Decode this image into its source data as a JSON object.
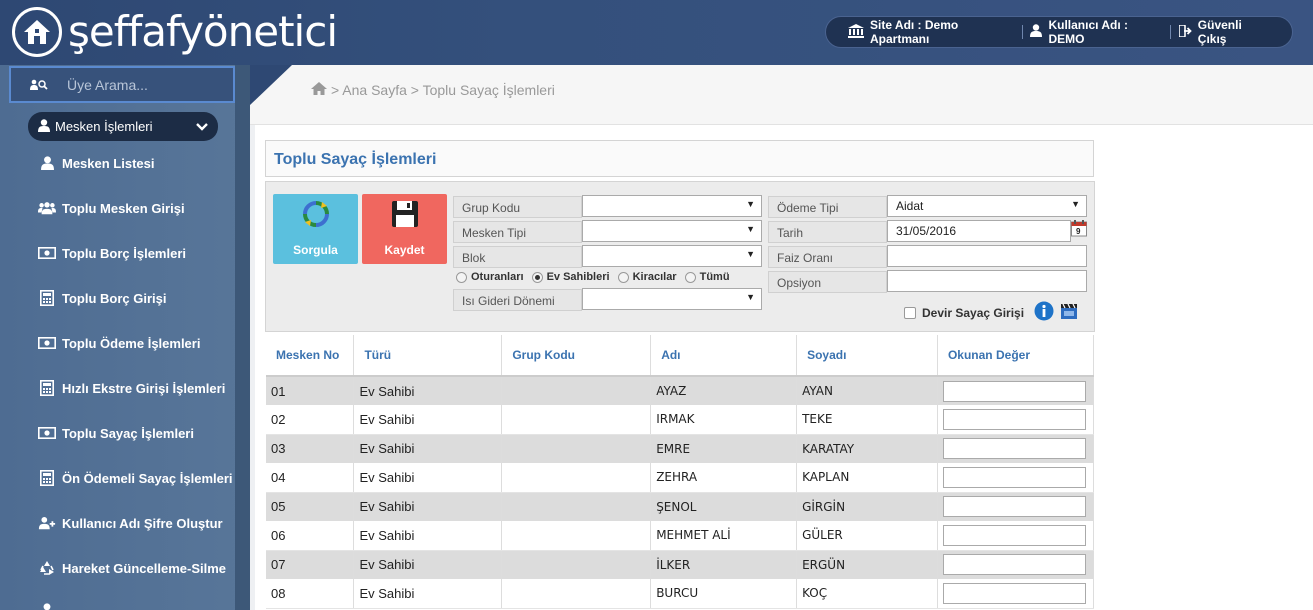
{
  "header": {
    "logo_text": "şeffafyönetici",
    "site": "Site Adı : Demo Apartmanı",
    "user": "Kullanıcı Adı : DEMO",
    "logout": "Güvenli Çıkış"
  },
  "sidebar": {
    "search_placeholder": "Üye Arama...",
    "group_label": "Mesken İşlemleri",
    "items": [
      {
        "label": "Mesken Listesi",
        "icon": "user-icon"
      },
      {
        "label": "Toplu Mesken Girişi",
        "icon": "users-icon"
      },
      {
        "label": "Toplu Borç İşlemleri",
        "icon": "money-icon"
      },
      {
        "label": "Toplu Borç Girişi",
        "icon": "calculator-icon"
      },
      {
        "label": "Toplu Ödeme İşlemleri",
        "icon": "money-icon"
      },
      {
        "label": "Hızlı Ekstre Girişi İşlemleri",
        "icon": "calculator-icon"
      },
      {
        "label": "Toplu Sayaç İşlemleri",
        "icon": "money-icon"
      },
      {
        "label": "Ön Ödemeli Sayaç İşlemleri",
        "icon": "calculator-icon"
      },
      {
        "label": "Kullanıcı Adı Şifre Oluştur",
        "icon": "user-plus-icon"
      },
      {
        "label": "Hareket Güncelleme-Silme",
        "icon": "recycle-icon"
      }
    ]
  },
  "breadcrumb": {
    "text": "> Ana Sayfa > Toplu Sayaç İşlemleri"
  },
  "panel": {
    "title": "Toplu Sayaç İşlemleri"
  },
  "buttons": {
    "query": "Sorgula",
    "save": "Kaydet"
  },
  "filters": {
    "grup_kodu": {
      "label": "Grup Kodu",
      "value": ""
    },
    "mesken_tipi": {
      "label": "Mesken Tipi",
      "value": ""
    },
    "blok": {
      "label": "Blok",
      "value": ""
    },
    "isi_gideri": {
      "label": "Isı Gideri Dönemi",
      "value": ""
    },
    "odeme_tipi": {
      "label": "Ödeme Tipi",
      "value": "Aidat"
    },
    "tarih": {
      "label": "Tarih",
      "value": "31/05/2016"
    },
    "faiz_orani": {
      "label": "Faiz Oranı",
      "value": ""
    },
    "opsiyon": {
      "label": "Opsiyon",
      "value": ""
    },
    "radios": [
      {
        "label": "Oturanları",
        "checked": false
      },
      {
        "label": "Ev Sahibleri",
        "checked": true
      },
      {
        "label": "Kiracılar",
        "checked": false
      },
      {
        "label": "Tümü",
        "checked": false
      }
    ],
    "devir_label": "Devir Sayaç Girişi"
  },
  "table": {
    "headers": [
      "Mesken No",
      "Türü",
      "Grup Kodu",
      "Adı",
      "Soyadı",
      "Okunan Değer"
    ],
    "rows": [
      [
        "01",
        "Ev Sahibi",
        "",
        "AYAZ",
        "AYAN",
        ""
      ],
      [
        "02",
        "Ev Sahibi",
        "",
        "IRMAK",
        "TEKE",
        ""
      ],
      [
        "03",
        "Ev Sahibi",
        "",
        "EMRE",
        "KARATAY",
        ""
      ],
      [
        "04",
        "Ev Sahibi",
        "",
        "ZEHRA",
        "KAPLAN",
        ""
      ],
      [
        "05",
        "Ev Sahibi",
        "",
        "ŞENOL",
        "GİRGİN",
        ""
      ],
      [
        "06",
        "Ev Sahibi",
        "",
        "MEHMET ALİ",
        "GÜLER",
        ""
      ],
      [
        "07",
        "Ev Sahibi",
        "",
        "İLKER",
        "ERGÜN",
        ""
      ],
      [
        "08",
        "Ev Sahibi",
        "",
        "BURCU",
        "KOÇ",
        ""
      ]
    ]
  }
}
